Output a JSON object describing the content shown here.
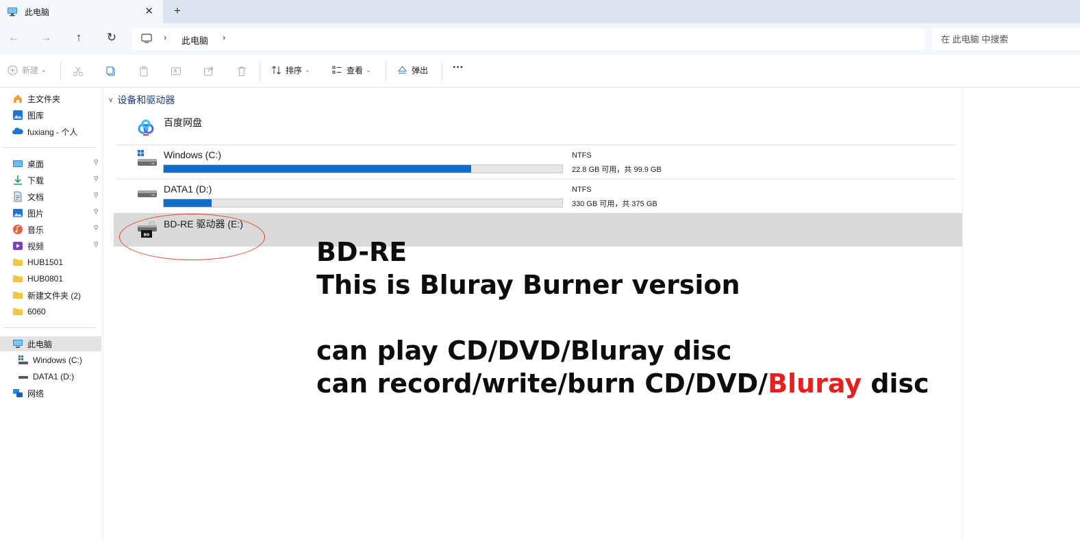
{
  "window": {
    "tab_title": "此电脑",
    "new_tab": "+",
    "tab_close": "✕"
  },
  "nav": {
    "back": "←",
    "forward": "→",
    "up": "↑",
    "refresh": "↻",
    "breadcrumb_sep": "›",
    "breadcrumb": [
      "此电脑"
    ],
    "search_placeholder": "在 此电脑 中搜索"
  },
  "toolbar": {
    "new_label": "新建",
    "sort_label": "排序",
    "view_label": "查看",
    "eject_label": "弹出",
    "more_label": "···"
  },
  "sidebar": {
    "items": [
      {
        "label": "主文件夹",
        "icon": "home-icon"
      },
      {
        "label": "图库",
        "icon": "gallery-icon"
      },
      {
        "label": "fuxiang - 个人",
        "icon": "onedrive-icon"
      },
      {
        "label": "桌面",
        "icon": "desktop-icon",
        "pinned": true
      },
      {
        "label": "下载",
        "icon": "download-icon",
        "pinned": true
      },
      {
        "label": "文档",
        "icon": "document-icon",
        "pinned": true
      },
      {
        "label": "图片",
        "icon": "pictures-icon",
        "pinned": true
      },
      {
        "label": "音乐",
        "icon": "music-icon",
        "pinned": true
      },
      {
        "label": "视频",
        "icon": "video-icon",
        "pinned": true
      },
      {
        "label": "HUB1501",
        "icon": "folder-icon"
      },
      {
        "label": "HUB0801",
        "icon": "folder-icon"
      },
      {
        "label": "新建文件夹 (2)",
        "icon": "folder-icon"
      },
      {
        "label": "6060",
        "icon": "folder-icon"
      },
      {
        "label": "此电脑",
        "icon": "pc-icon",
        "selected": true
      },
      {
        "label": "Windows (C:)",
        "icon": "drive-icon"
      },
      {
        "label": "DATA1 (D:)",
        "icon": "drive-icon"
      },
      {
        "label": "网络",
        "icon": "network-icon"
      }
    ],
    "pin_glyph": "📌"
  },
  "main": {
    "group_title": "设备和驱动器",
    "group_chevron": "∨",
    "drives": [
      {
        "name": "百度网盘",
        "icon": "baidu-netdisk-icon"
      },
      {
        "name": "Windows (C:)",
        "icon": "windows-drive-icon",
        "fs": "NTFS",
        "space": "22.8 GB 可用，共 99.9 GB",
        "used_fraction": 0.772
      },
      {
        "name": "DATA1 (D:)",
        "icon": "hdd-icon",
        "fs": "NTFS",
        "space": "330 GB 可用，共 375 GB",
        "used_fraction": 0.12
      },
      {
        "name": "BD-RE 驱动器 (E:)",
        "icon": "bd-drive-icon",
        "selected": true
      }
    ]
  },
  "overlay": {
    "line1": "BD-RE",
    "line2": "This is Bluray Burner version",
    "line3": "can play CD/DVD/Bluray disc",
    "line4_prefix": "can record/write/burn CD/DVD/",
    "line4_highlight": "Bluray",
    "line4_suffix": " disc"
  },
  "colors": {
    "accent": "#0f6cc9",
    "highlight_red": "#e5201e",
    "annotation_red": "#e0412a"
  }
}
